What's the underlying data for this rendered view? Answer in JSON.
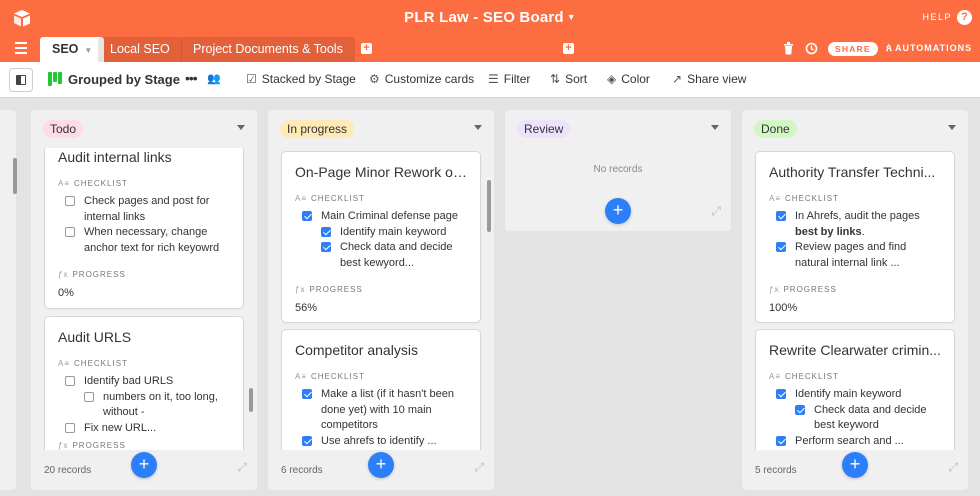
{
  "app": {
    "base_title": "PLR Law - SEO Board",
    "help_label": "HELP",
    "help_icon": "?"
  },
  "tabs": [
    {
      "label": "SEO",
      "active": true
    },
    {
      "label": "Local SEO",
      "active": false
    },
    {
      "label": "Project Documents & Tools",
      "active": false
    }
  ],
  "header_actions": {
    "share_label": "SHARE",
    "automations_label": "AUTOMATIONS"
  },
  "toolbar": {
    "view_name": "Grouped by Stage",
    "stacked_by": "Stacked by Stage",
    "customize_cards": "Customize cards",
    "filter": "Filter",
    "sort": "Sort",
    "color": "Color",
    "share_view": "Share view"
  },
  "field_labels": {
    "checklist": "CHECKLIST",
    "progress": "PROGRESS"
  },
  "columns": [
    {
      "name": "Todo",
      "color": "#ffdce5",
      "count_label": "20 records",
      "cards": [
        {
          "title": "Audit internal links",
          "checklist": [
            {
              "text": "Check pages and post for internal links",
              "checked": false,
              "sub": false
            },
            {
              "text": "When necessary, change anchor text for rich keyowrd",
              "checked": false,
              "sub": false
            }
          ],
          "progress": "0%"
        },
        {
          "title": "Audit URLS",
          "checklist": [
            {
              "text": "Identify bad URLS",
              "checked": false,
              "sub": false
            },
            {
              "text": "numbers on it, too long, without -",
              "checked": false,
              "sub": true
            },
            {
              "text": "Fix new URL...",
              "checked": false,
              "sub": false
            }
          ],
          "progress": ""
        }
      ]
    },
    {
      "name": "In progress",
      "color": "#ffeab6",
      "count_label": "6 records",
      "cards": [
        {
          "title": "On-Page Minor Rework of...",
          "checklist": [
            {
              "text": "Main Criminal defense page",
              "checked": true,
              "sub": false
            },
            {
              "text": "Identify main keyword",
              "checked": true,
              "sub": true
            },
            {
              "text": "Check data and decide best kewyord...",
              "checked": true,
              "sub": true
            }
          ],
          "progress": "56%"
        },
        {
          "title": "Competitor analysis",
          "checklist": [
            {
              "text": "Make a list (if it hasn't been done yet) with 10 main competitors",
              "checked": true,
              "sub": false
            },
            {
              "text": "Use ahrefs to identify ...",
              "checked": true,
              "sub": false
            }
          ],
          "progress": ""
        }
      ]
    },
    {
      "name": "Review",
      "color": "#ede2fe",
      "count_label": "",
      "no_records": "No records",
      "cards": []
    },
    {
      "name": "Done",
      "color": "#d1f7c4",
      "count_label": "5 records",
      "cards": [
        {
          "title": "Authority Transfer Techni...",
          "checklist": [
            {
              "text": "In Ahrefs, audit the pages ",
              "bold": "best by links",
              "tail": ".",
              "checked": true,
              "sub": false
            },
            {
              "text": "Review pages and find natural internal link ...",
              "checked": true,
              "sub": false
            }
          ],
          "progress": "100%"
        },
        {
          "title": "Rewrite Clearwater crimin...",
          "checklist": [
            {
              "text": "Identify main keyword",
              "checked": true,
              "sub": false
            },
            {
              "text": "Check data and decide best keyword",
              "checked": true,
              "sub": true
            },
            {
              "text": "Perform search and ...",
              "checked": true,
              "sub": false
            }
          ],
          "progress": ""
        }
      ]
    }
  ],
  "colors": {
    "brand": "#fc6d42",
    "accent": "#2d7ff9",
    "view_icon": "#20c933"
  }
}
